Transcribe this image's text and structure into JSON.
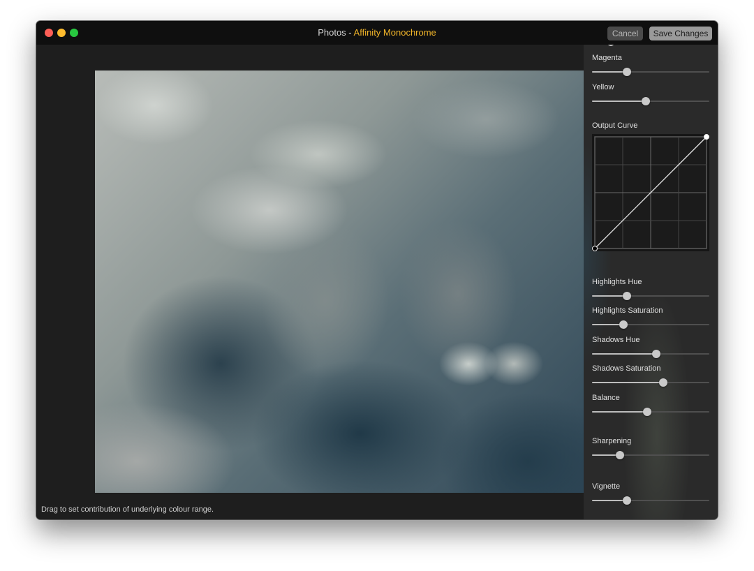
{
  "window": {
    "title_app": "Photos",
    "title_separator": " - ",
    "title_extension": "Affinity Monochrome",
    "accent_color": "#f0b429",
    "buttons": {
      "cancel_label": "Cancel",
      "save_label": "Save Changes"
    }
  },
  "canvas": {
    "image_description": "Monochrome-toned salad photo (tomatoes, cucumber, lettuce) with cool blue tint",
    "status_text": "Drag to set contribution of underlying colour range."
  },
  "panel": {
    "sliders_top": [
      {
        "label": "Magenta",
        "value": 0.3
      },
      {
        "label": "Yellow",
        "value": 0.46
      }
    ],
    "output_curve": {
      "label": "Output Curve",
      "points": [
        [
          0,
          0
        ],
        [
          1,
          1
        ]
      ],
      "grid_divisions": 4
    },
    "sliders_bottom": [
      {
        "label": "Highlights Hue",
        "value": 0.3
      },
      {
        "label": "Highlights Saturation",
        "value": 0.27
      },
      {
        "label": "Shadows Hue",
        "value": 0.55
      },
      {
        "label": "Shadows Saturation",
        "value": 0.61
      },
      {
        "label": "Balance",
        "value": 0.47
      },
      {
        "label": "Sharpening",
        "value": 0.24
      },
      {
        "label": "Vignette",
        "value": 0.3
      }
    ]
  }
}
